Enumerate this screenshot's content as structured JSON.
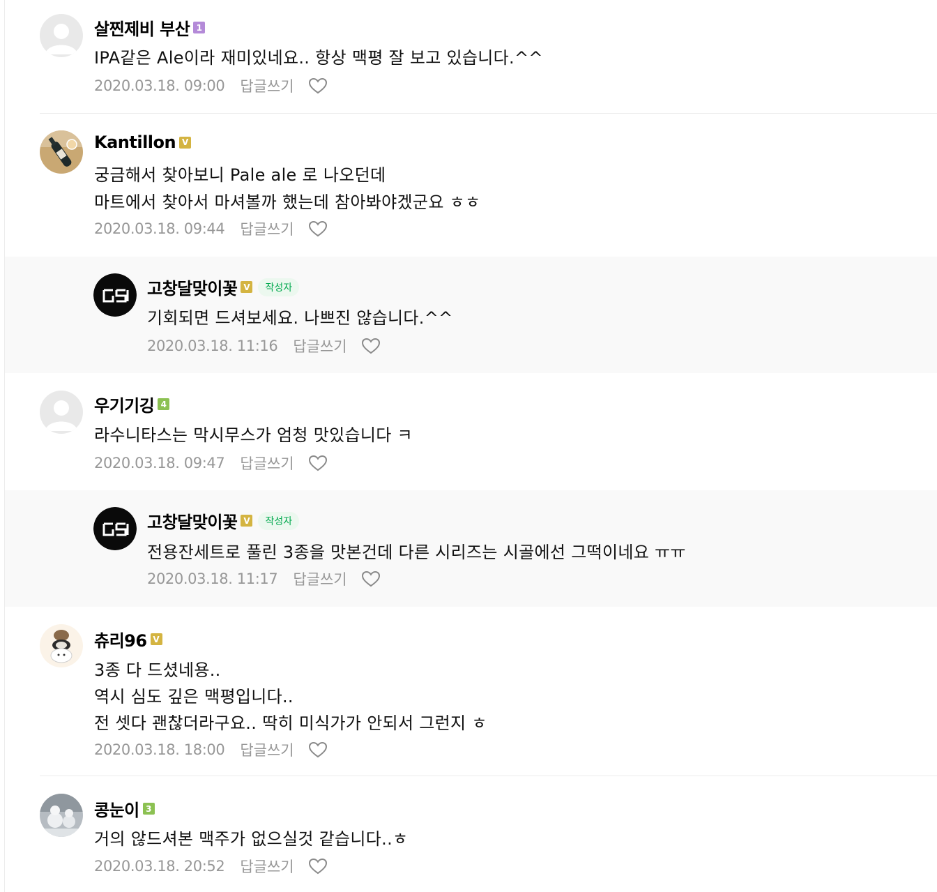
{
  "comments": [
    {
      "author": "살찐제비 부산",
      "level": "1",
      "level_color": "#b48ad8",
      "avatar": "default-profile-icon",
      "lines": [
        "IPA같은 Ale이라 재미있네요.. 항상 맥평 잘 보고 있습니다.^^"
      ],
      "date": "2020.03.18. 09:00",
      "reply_label": "답글쓰기"
    },
    {
      "author": "Kantillon",
      "level": "V",
      "level_color": "#d4b441",
      "avatar": "beer-bottle-photo",
      "lines": [
        "궁금해서 찾아보니 Pale ale 로 나오던데",
        "마트에서 찾아서 마셔볼까 했는데 참아봐야겠군요 ㅎㅎ"
      ],
      "date": "2020.03.18. 09:44",
      "reply_label": "답글쓰기"
    },
    {
      "author": "고창달맞이꽃",
      "level": "V",
      "level_color": "#d4b441",
      "writer_badge": "작성자",
      "avatar": "gsd-logo",
      "lines": [
        "기회되면 드셔보세요. 나쁘진 않습니다.^^"
      ],
      "date": "2020.03.18. 11:16",
      "reply_label": "답글쓰기"
    },
    {
      "author": "우기기깅",
      "level": "4",
      "level_color": "#8cc152",
      "avatar": "default-profile-icon",
      "lines": [
        "라수니타스는 막시무스가 엄청 맛있습니다 ㅋ"
      ],
      "date": "2020.03.18. 09:47",
      "reply_label": "답글쓰기"
    },
    {
      "author": "고창달맞이꽃",
      "level": "V",
      "level_color": "#d4b441",
      "writer_badge": "작성자",
      "avatar": "gsd-logo",
      "lines": [
        "전용잔세트로 풀린 3종을 맛본건데 다른 시리즈는 시골에선 그떡이네요 ㅠㅠ"
      ],
      "date": "2020.03.18. 11:17",
      "reply_label": "답글쓰기"
    },
    {
      "author": "츄리96",
      "level": "V",
      "level_color": "#d4b441",
      "avatar": "bear-illustration",
      "lines": [
        "3종 다 드셨네용..",
        "역시 심도 깊은 맥평입니다..",
        "전 셋다 괜찮더라구요.. 딱히 미식가가 안되서 그런지 ㅎ"
      ],
      "date": "2020.03.18. 18:00",
      "reply_label": "답글쓰기"
    },
    {
      "author": "콩눈이",
      "level": "3",
      "level_color": "#8cc152",
      "avatar": "snowman-photo",
      "lines": [
        "거의 않드셔본 맥주가 없으실것 같습니다..ㅎ"
      ],
      "date": "2020.03.18. 20:52",
      "reply_label": "답글쓰기"
    }
  ]
}
